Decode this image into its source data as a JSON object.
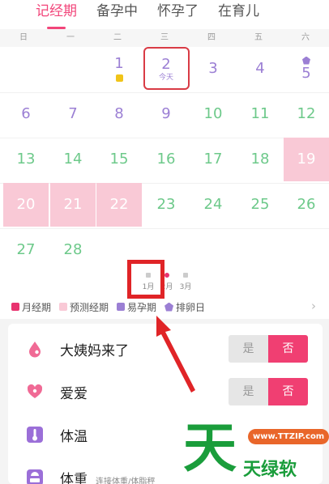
{
  "tabs": [
    {
      "label": "记经期",
      "active": true
    },
    {
      "label": "备孕中"
    },
    {
      "label": "怀孕了"
    },
    {
      "label": "在育儿"
    }
  ],
  "weekdays": [
    "日",
    "一",
    "二",
    "三",
    "四",
    "五",
    "六"
  ],
  "calendar": {
    "today_label": "今天",
    "days": {
      "d1": "1",
      "d2": "2",
      "d3": "3",
      "d4": "4",
      "d5": "5",
      "d6": "6",
      "d7": "7",
      "d8": "8",
      "d9": "9",
      "d10": "10",
      "d11": "11",
      "d12": "12",
      "d13": "13",
      "d14": "14",
      "d15": "15",
      "d16": "16",
      "d17": "17",
      "d18": "18",
      "d19": "19",
      "d20": "20",
      "d21": "21",
      "d22": "22",
      "d23": "23",
      "d24": "24",
      "d25": "25",
      "d26": "26",
      "d27": "27",
      "d28": "28"
    }
  },
  "month_scroller": [
    "1月",
    "2月",
    "3月"
  ],
  "legend": [
    {
      "label": "月经期",
      "color": "#e8336f"
    },
    {
      "label": "预测经期",
      "color": "#f9c9d6"
    },
    {
      "label": "易孕期",
      "color": "#9b7fd4"
    },
    {
      "label": "排卵日",
      "color": "#9b7fd4"
    }
  ],
  "rows": [
    {
      "label": "大姨妈来了",
      "yes": "是",
      "no": "否",
      "icon": "drop-icon"
    },
    {
      "label": "爱爱",
      "yes": "是",
      "no": "否",
      "icon": "heart-icon"
    },
    {
      "label": "体温",
      "icon": "thermometer-icon"
    },
    {
      "label": "体重",
      "sub": "连接体重/体脂秤",
      "icon": "scale-icon"
    }
  ],
  "watermark": {
    "big": "天",
    "url": "www.TTZIP.com",
    "text": "天绿软"
  },
  "colors": {
    "accent": "#f2457a",
    "purple": "#9b7fd4",
    "green": "#6dc98a",
    "pink_bg": "#f9c9d6"
  }
}
